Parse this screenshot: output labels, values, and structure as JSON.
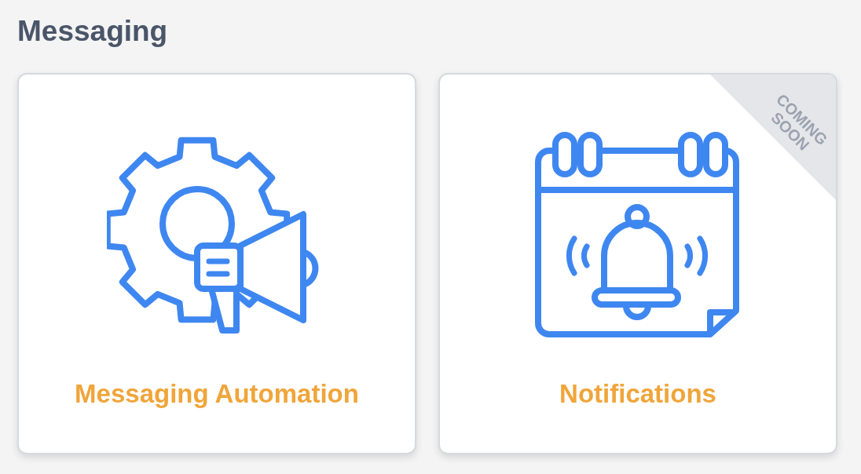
{
  "section": {
    "title": "Messaging"
  },
  "cards": [
    {
      "label": "Messaging Automation"
    },
    {
      "label": "Notifications",
      "badge": "COMING SOON"
    }
  ]
}
